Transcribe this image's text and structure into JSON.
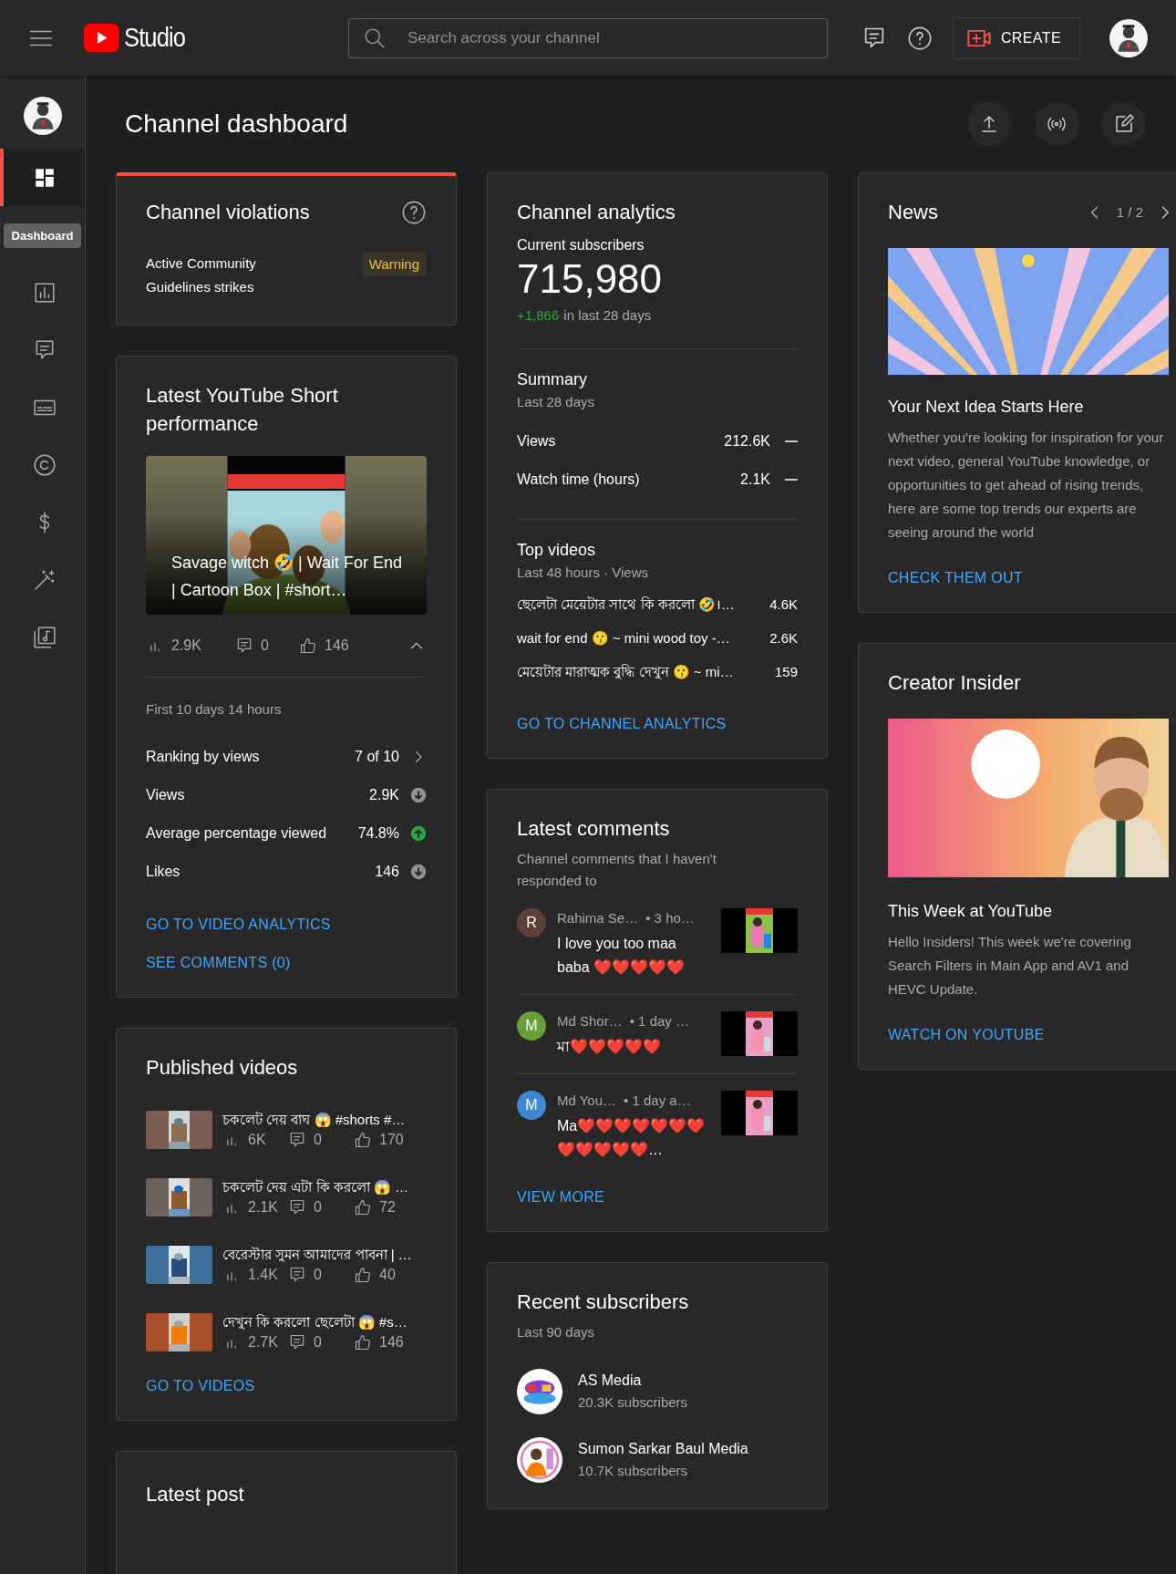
{
  "topbar": {
    "logo_text": "Studio",
    "search": {
      "placeholder": "Search across your channel"
    },
    "create_button": "CREATE"
  },
  "sidebar": {
    "tooltip": "Dashboard",
    "items": [
      {
        "kind": "dashboard",
        "selected": true
      },
      {
        "kind": "analytics",
        "selected": false
      },
      {
        "kind": "comments",
        "selected": false
      },
      {
        "kind": "subtitles",
        "selected": false
      },
      {
        "kind": "copyright",
        "selected": false
      },
      {
        "kind": "earn",
        "selected": false
      },
      {
        "kind": "customization",
        "selected": false
      },
      {
        "kind": "audio",
        "selected": false
      }
    ]
  },
  "page": {
    "title": "Channel dashboard"
  },
  "columns": [
    {
      "cards": [
        {
          "kind": "violations",
          "title": "Channel violations",
          "label": "Active Community Guidelines strikes",
          "badge": "Warning"
        },
        {
          "kind": "short",
          "title": "Latest YouTube Short performance",
          "video_title": "Savage witch 🤣 | Wait For End | Cartoon Box | #short…",
          "views": "2.9K",
          "comments": "0",
          "likes": "146",
          "expanded": true,
          "period": "First 10 days 14 hours",
          "metrics": [
            {
              "kind": "ranking",
              "label": "Ranking by views",
              "value": "7 of 10"
            },
            {
              "kind": "down",
              "label": "Views",
              "value": "2.9K"
            },
            {
              "kind": "up",
              "label": "Average percentage viewed",
              "value": "74.8%"
            },
            {
              "kind": "down",
              "label": "Likes",
              "value": "146"
            }
          ],
          "links": [
            "GO TO VIDEO ANALYTICS",
            "SEE COMMENTS (0)"
          ]
        },
        {
          "kind": "published",
          "title": "Published videos",
          "videos": [
            {
              "title": "চকলেট দেয় বাঘ 😱 #shorts #…",
              "views": "6K",
              "comments": "0",
              "likes": "170"
            },
            {
              "title": "চকলেট দেয় এটা কি করলো 😱 …",
              "views": "2.1K",
              "comments": "0",
              "likes": "72"
            },
            {
              "title": "বেরেস্টার সুমন আমাদের পাবনা | …",
              "views": "1.4K",
              "comments": "0",
              "likes": "40"
            },
            {
              "title": "দেখুন কি করলো ছেলেটা 😱 #s…",
              "views": "2.7K",
              "comments": "0",
              "likes": "146"
            }
          ],
          "link": "GO TO VIDEOS"
        },
        {
          "kind": "post",
          "title": "Latest post"
        }
      ]
    },
    {
      "cards": [
        {
          "kind": "analytics",
          "title": "Channel analytics",
          "subscribers_label": "Current subscribers",
          "subscribers": "715,980",
          "change": "+1,866",
          "change_period": "in last 28 days",
          "summary": {
            "title": "Summary",
            "period": "Last 28 days",
            "rows": [
              {
                "kind": "flat",
                "label": "Views",
                "value": "212.6K"
              },
              {
                "kind": "flat",
                "label": "Watch time (hours)",
                "value": "2.1K"
              }
            ]
          },
          "top_videos": {
            "title": "Top videos",
            "period": "Last 48 hours · Views",
            "rows": [
              {
                "title": "ছেলেটা মেয়েটার সাথে কি করলো 🤣।…",
                "views": "4.6K"
              },
              {
                "title": "wait for end 😗 ~ mini wood toy -…",
                "views": "2.6K"
              },
              {
                "title": "মেয়েটার মারাত্মক বুদ্ধি দেখুন 😗 ~ mi…",
                "views": "159"
              }
            ]
          },
          "link": "GO TO CHANNEL ANALYTICS"
        },
        {
          "kind": "comments",
          "title": "Latest comments",
          "subtitle": "Channel comments that I haven't responded to",
          "comments": [
            {
              "initial": "R",
              "color": "#5d4037",
              "author": "Rahima Se…",
              "time": "• 3 ho…",
              "text": "I love you too maa baba ❤️❤️❤️❤️❤️"
            },
            {
              "initial": "M",
              "color": "#689f38",
              "author": "Md Shor…",
              "time": "• 1 day …",
              "text": "মা❤️❤️❤️❤️❤️"
            },
            {
              "initial": "M",
              "color": "#3f88d4",
              "author": "Md You…",
              "time": "• 1 day a…",
              "text": "Ma❤️❤️❤️❤️❤️❤️❤️❤️❤️❤️❤️❤️…"
            }
          ],
          "link": "VIEW MORE"
        },
        {
          "kind": "subscribers",
          "title": "Recent subscribers",
          "period": "Last 90 days",
          "items": [
            {
              "name": "AS Media",
              "count": "20.3K subscribers"
            },
            {
              "name": "Sumon Sarkar Baul Media",
              "count": "10.7K subscribers"
            }
          ]
        }
      ]
    },
    {
      "cards": [
        {
          "kind": "news",
          "title": "News",
          "pager": "1 / 2",
          "headline": "Your Next Idea Starts Here",
          "body": "Whether you're looking for inspiration for your next video, general YouTube knowledge, or opportunities to get ahead of rising trends, here are some top trends our experts are seeing around the world",
          "link": "CHECK THEM OUT"
        },
        {
          "kind": "insider",
          "title": "Creator Insider",
          "headline": "This Week at YouTube",
          "body": "Hello Insiders! This week we're covering Search Filters in Main App and AV1 and HEVC Update.",
          "link": "WATCH ON YOUTUBE"
        }
      ]
    }
  ]
}
